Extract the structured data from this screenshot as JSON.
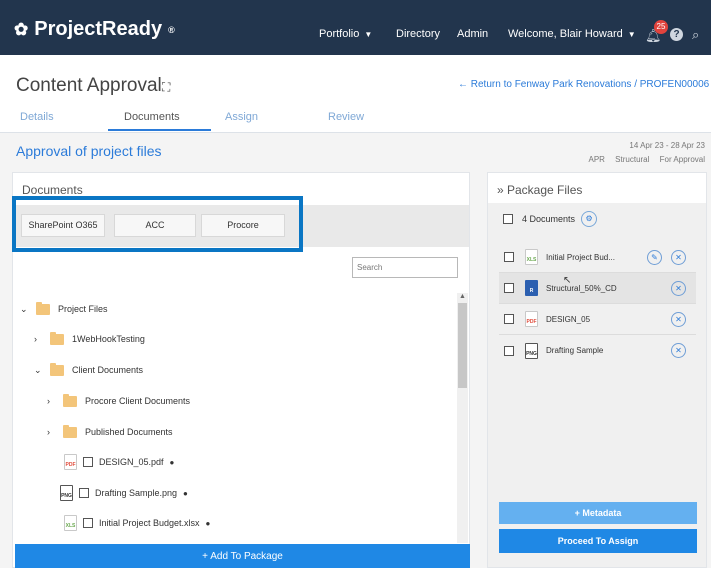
{
  "topbar": {
    "logo": "ProjectReady",
    "logo_mark": "✿",
    "reg": "®",
    "nav": [
      "Portfolio",
      "Directory",
      "Admin",
      "Welcome, Blair Howard"
    ],
    "notifications": "25",
    "help": "?",
    "search_icon": "⌕"
  },
  "header": {
    "title": "Content Approval",
    "return_link": "← Return to Fenway Park Renovations / PROFEN00006",
    "tabs": [
      "Details",
      "Documents",
      "Assign",
      "Review"
    ]
  },
  "approval": {
    "title": "Approval of project files",
    "dates": "14 Apr 23 - 28 Apr 23",
    "tags": [
      "APR",
      "Structural",
      "For Approval"
    ]
  },
  "documents": {
    "title": "Documents",
    "sources": [
      "SharePoint O365",
      "ACC",
      "Procore"
    ],
    "search_placeholder": "Search",
    "tree": [
      {
        "label": "Project Files",
        "type": "folder",
        "chevron": "⌄"
      },
      {
        "label": "1WebHookTesting",
        "type": "folder",
        "chevron": "›"
      },
      {
        "label": "Client Documents",
        "type": "folder",
        "chevron": "⌄"
      },
      {
        "label": "Procore Client Documents",
        "type": "folder",
        "chevron": "›"
      },
      {
        "label": "Published Documents",
        "type": "folder",
        "chevron": "›"
      },
      {
        "label": "DESIGN_05.pdf",
        "type": "file",
        "icon": "PDF"
      },
      {
        "label": "Drafting Sample.png",
        "type": "file",
        "icon": "PNG"
      },
      {
        "label": "Initial Project Budget.xlsx",
        "type": "file",
        "icon": "XLS"
      }
    ],
    "add_button": "+ Add To Package"
  },
  "package": {
    "title": "» Package Files",
    "count": "4 Documents",
    "files": [
      {
        "label": "Initial Project Bud...",
        "icon": "XLS"
      },
      {
        "label": "Structural_50%_CD",
        "icon": "R"
      },
      {
        "label": "DESIGN_05",
        "icon": "PDF"
      },
      {
        "label": "Drafting Sample",
        "icon": "PNG"
      }
    ],
    "metadata_button": "+ Metadata",
    "proceed_button": "Proceed To Assign"
  }
}
